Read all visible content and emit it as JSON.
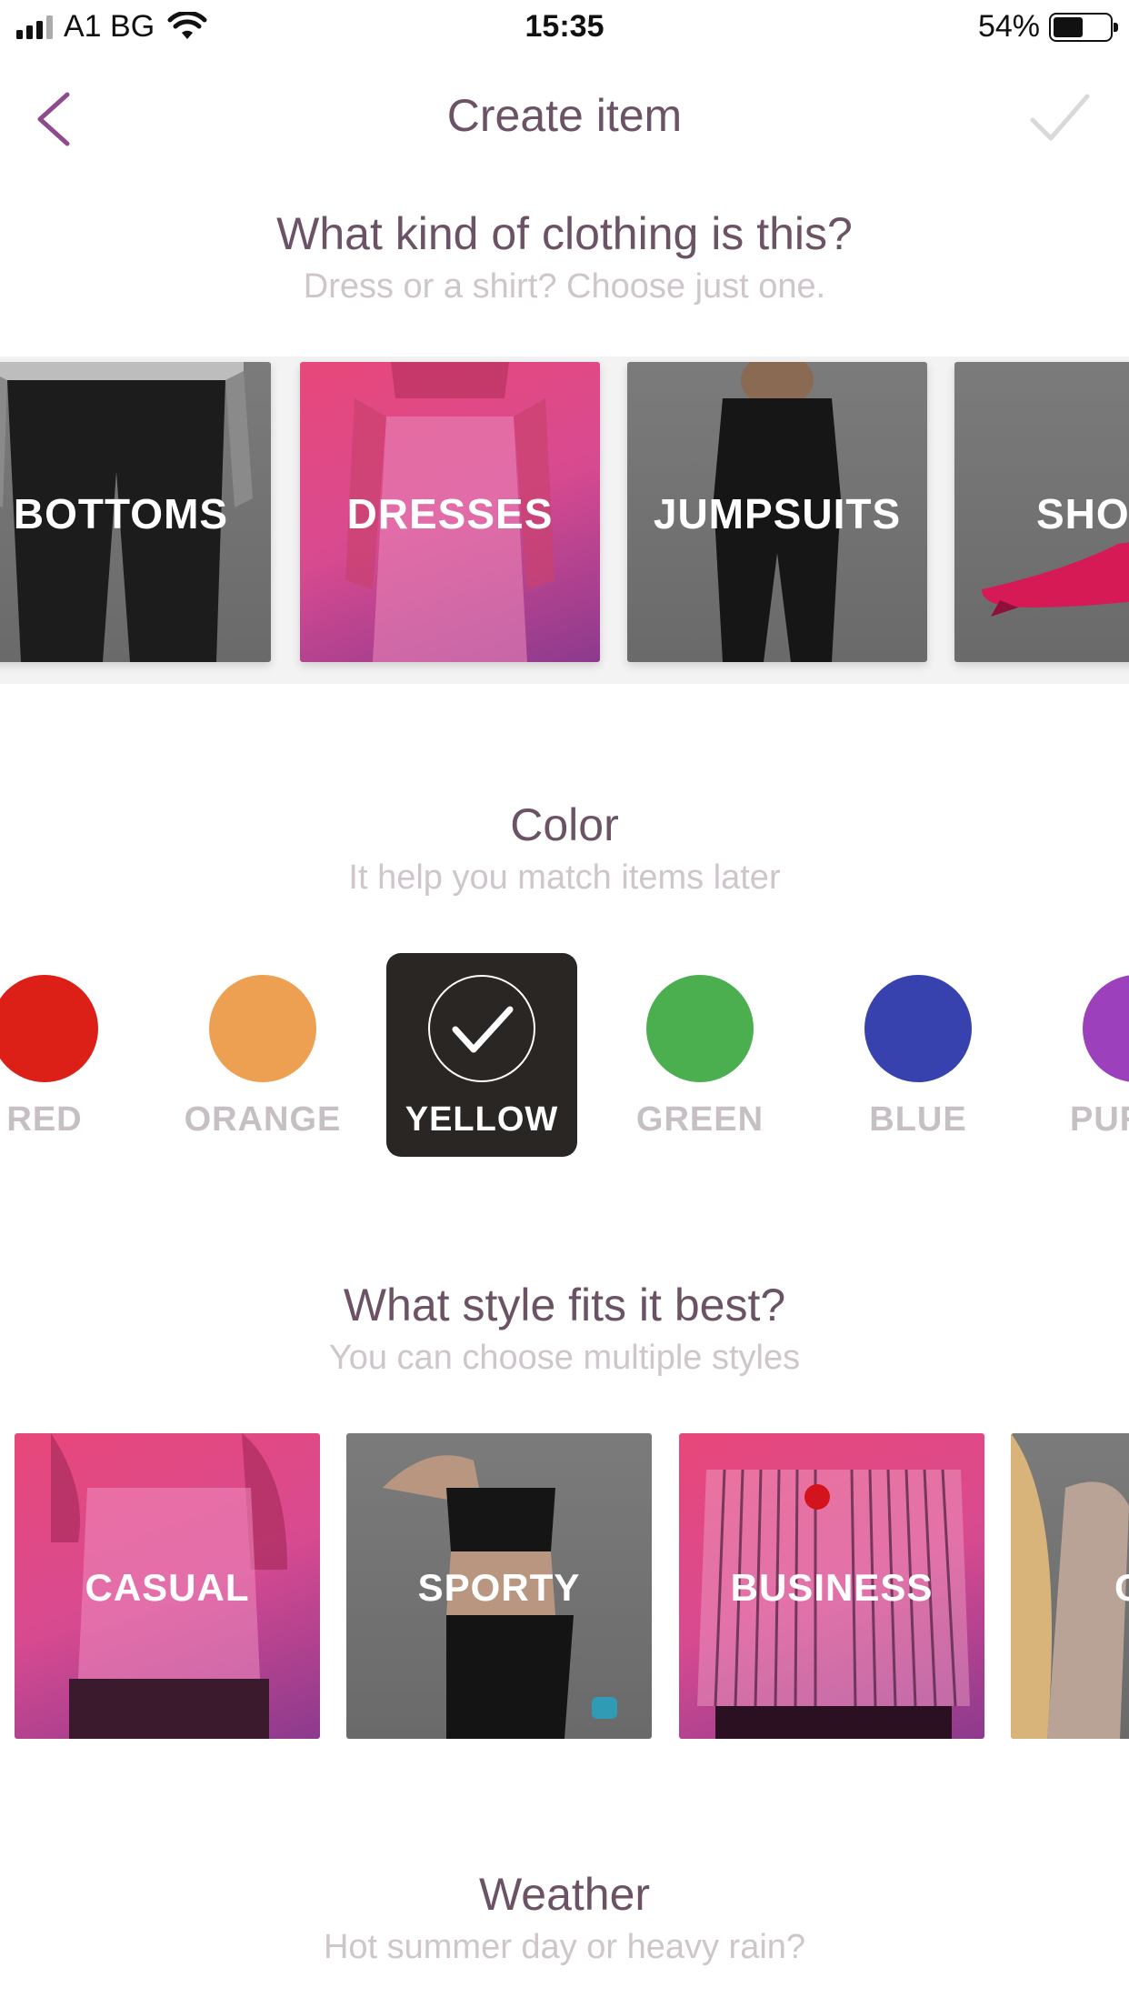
{
  "status_bar": {
    "carrier": "A1 BG",
    "time": "15:35",
    "battery": "54%",
    "battery_level": 0.54
  },
  "nav": {
    "title": "Create item",
    "back_icon": "chevron-left-icon",
    "done_icon": "checkmark-icon"
  },
  "clothing": {
    "title": "What kind of clothing is this?",
    "subtitle": "Dress or a shirt? Choose just one.",
    "items": [
      {
        "label": "BOTTOMS",
        "selected": false
      },
      {
        "label": "DRESSES",
        "selected": true
      },
      {
        "label": "JUMPSUITS",
        "selected": false
      },
      {
        "label": "SHOES",
        "selected": false
      }
    ]
  },
  "color": {
    "title": "Color",
    "subtitle": "It help you match items later",
    "items": [
      {
        "label": "RED",
        "hex": "#dc1f17",
        "selected": false
      },
      {
        "label": "ORANGE",
        "hex": "#eea052",
        "selected": false
      },
      {
        "label": "YELLOW",
        "hex": "#f5d23c",
        "selected": true
      },
      {
        "label": "GREEN",
        "hex": "#4baf50",
        "selected": false
      },
      {
        "label": "BLUE",
        "hex": "#3842af",
        "selected": false
      },
      {
        "label": "PURPLE",
        "hex": "#9c40bc",
        "selected": false
      }
    ]
  },
  "style": {
    "title": "What style fits it best?",
    "subtitle": "You can choose multiple styles",
    "items": [
      {
        "label": "CASUAL",
        "selected": true
      },
      {
        "label": "SPORTY",
        "selected": false
      },
      {
        "label": "BUSINESS",
        "selected": true
      },
      {
        "label": "CHIC",
        "selected": false
      }
    ]
  },
  "weather": {
    "title": "Weather",
    "subtitle": "Hot summer day or heavy rain?"
  },
  "colors": {
    "accent": "#8e4a8c",
    "title_text": "#6b5365",
    "subtitle_text": "#cfc6cc",
    "selected_swatch_bg": "#2a2624"
  }
}
